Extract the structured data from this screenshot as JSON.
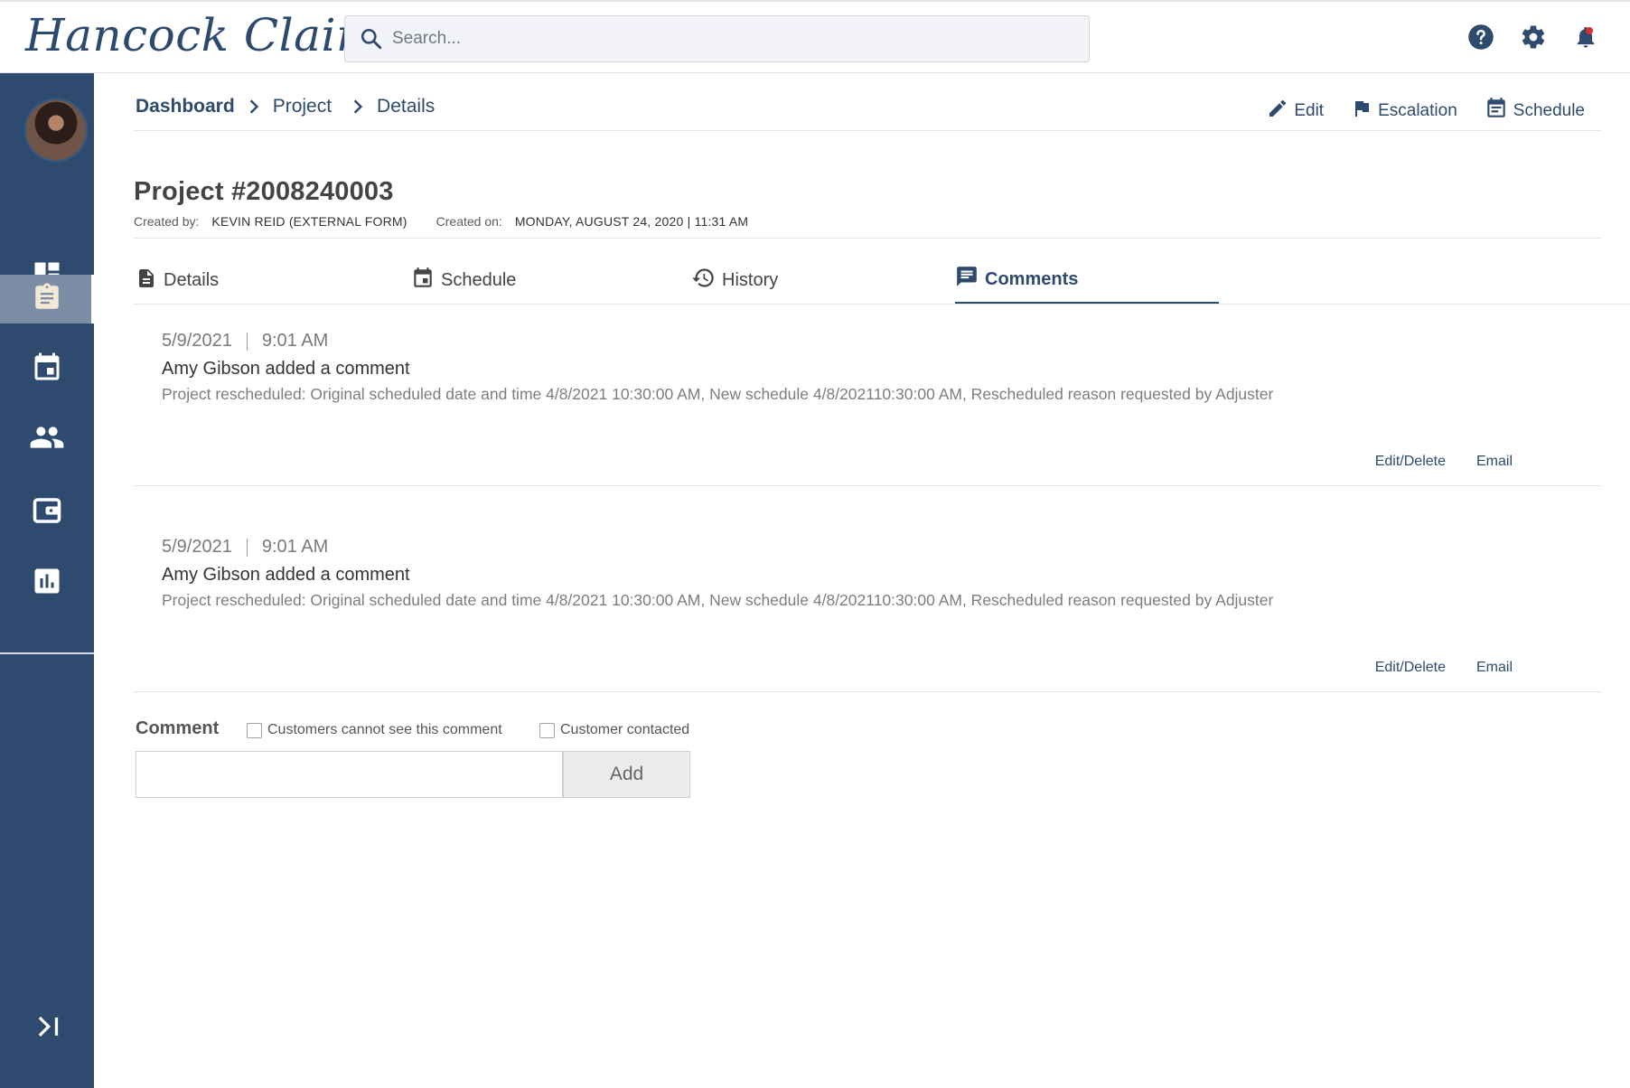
{
  "app": {
    "logo_text": "Hancock Claims"
  },
  "search": {
    "placeholder": "Search..."
  },
  "header_icons": [
    "help-icon",
    "gear-icon",
    "bell-icon"
  ],
  "sidebar": {
    "items": [
      {
        "name": "dashboard",
        "icon": "dashboard-icon"
      },
      {
        "name": "projects",
        "icon": "clipboard-icon",
        "active": true
      },
      {
        "name": "calendar",
        "icon": "calendar-icon"
      },
      {
        "name": "people",
        "icon": "people-icon"
      },
      {
        "name": "wallet",
        "icon": "wallet-icon"
      },
      {
        "name": "reports",
        "icon": "bar-chart-icon"
      }
    ],
    "expand_icon": "expand-icon"
  },
  "breadcrumb": {
    "items": [
      "Dashboard",
      "Project",
      "Details"
    ]
  },
  "actions": {
    "edit": "Edit",
    "escalation": "Escalation",
    "schedule": "Schedule"
  },
  "project": {
    "title": "Project #2008240003",
    "created_by_label": "Created by:",
    "created_by": "KEVIN REID (EXTERNAL FORM)",
    "created_on_label": "Created on:",
    "created_on": "MONDAY, AUGUST 24, 2020 | 11:31 AM"
  },
  "tabs": [
    {
      "label": "Details",
      "icon": "document-icon"
    },
    {
      "label": "Schedule",
      "icon": "calendar-icon"
    },
    {
      "label": "History",
      "icon": "history-icon"
    },
    {
      "label": "Comments",
      "icon": "comment-icon",
      "active": true
    }
  ],
  "comments": [
    {
      "date": "5/9/2021",
      "time": "9:01 AM",
      "author_line": "Amy Gibson added a comment",
      "body": "Project rescheduled: Original scheduled date and time 4/8/2021 10:30:00 AM, New schedule 4/8/202110:30:00 AM, Rescheduled reason requested by Adjuster",
      "edit_label": "Edit/Delete",
      "email_label": "Email"
    },
    {
      "date": "5/9/2021",
      "time": "9:01 AM",
      "author_line": "Amy Gibson added a comment",
      "body": "Project rescheduled: Original scheduled date and time 4/8/2021 10:30:00 AM, New schedule 4/8/202110:30:00 AM, Rescheduled reason requested by Adjuster",
      "edit_label": "Edit/Delete",
      "email_label": "Email"
    }
  ],
  "comment_form": {
    "label": "Comment",
    "private_checkbox": "Customers cannot see this comment",
    "contacted_checkbox": "Customer contacted",
    "input_value": "",
    "add_label": "Add"
  },
  "colors": {
    "brand": "#2e4a6e",
    "sidebar_active": "#7b8ea5",
    "notification": "#d8312b"
  }
}
